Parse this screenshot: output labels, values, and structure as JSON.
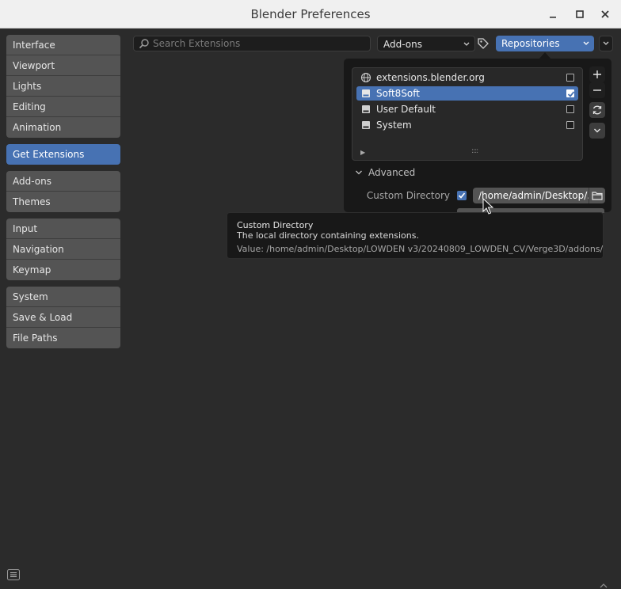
{
  "window": {
    "title": "Blender Preferences"
  },
  "sidebar": {
    "groups": [
      [
        "Interface",
        "Viewport",
        "Lights",
        "Editing",
        "Animation"
      ],
      [
        "Get Extensions"
      ],
      [
        "Add-ons",
        "Themes"
      ],
      [
        "Input",
        "Navigation",
        "Keymap"
      ],
      [
        "System",
        "Save & Load",
        "File Paths"
      ]
    ],
    "active": "Get Extensions"
  },
  "header": {
    "search_placeholder": "Search Extensions",
    "filter_label": "Add-ons",
    "repositories_label": "Repositories"
  },
  "repositories": [
    {
      "name": "extensions.blender.org",
      "icon": "globe-icon",
      "enabled": false,
      "selected": false
    },
    {
      "name": "Soft8Soft",
      "icon": "disk-icon",
      "enabled": true,
      "selected": true
    },
    {
      "name": "User Default",
      "icon": "disk-icon",
      "enabled": false,
      "selected": false
    },
    {
      "name": "System",
      "icon": "disk-icon",
      "enabled": false,
      "selected": false
    }
  ],
  "advanced": {
    "label": "Advanced",
    "custom_directory_label": "Custom Directory",
    "custom_directory_enabled": true,
    "custom_directory_value": "/home/admin/Desktop/..."
  },
  "tooltip": {
    "title": "Custom Directory",
    "description": "The local directory containing extensions.",
    "value": "Value: /home/admin/Desktop/LOWDEN v3/20240809_LOWDEN_CV/Verge3D/addons/"
  },
  "colors": {
    "accent": "#4772b3",
    "background": "#2b2b2b",
    "button": "#545454"
  }
}
